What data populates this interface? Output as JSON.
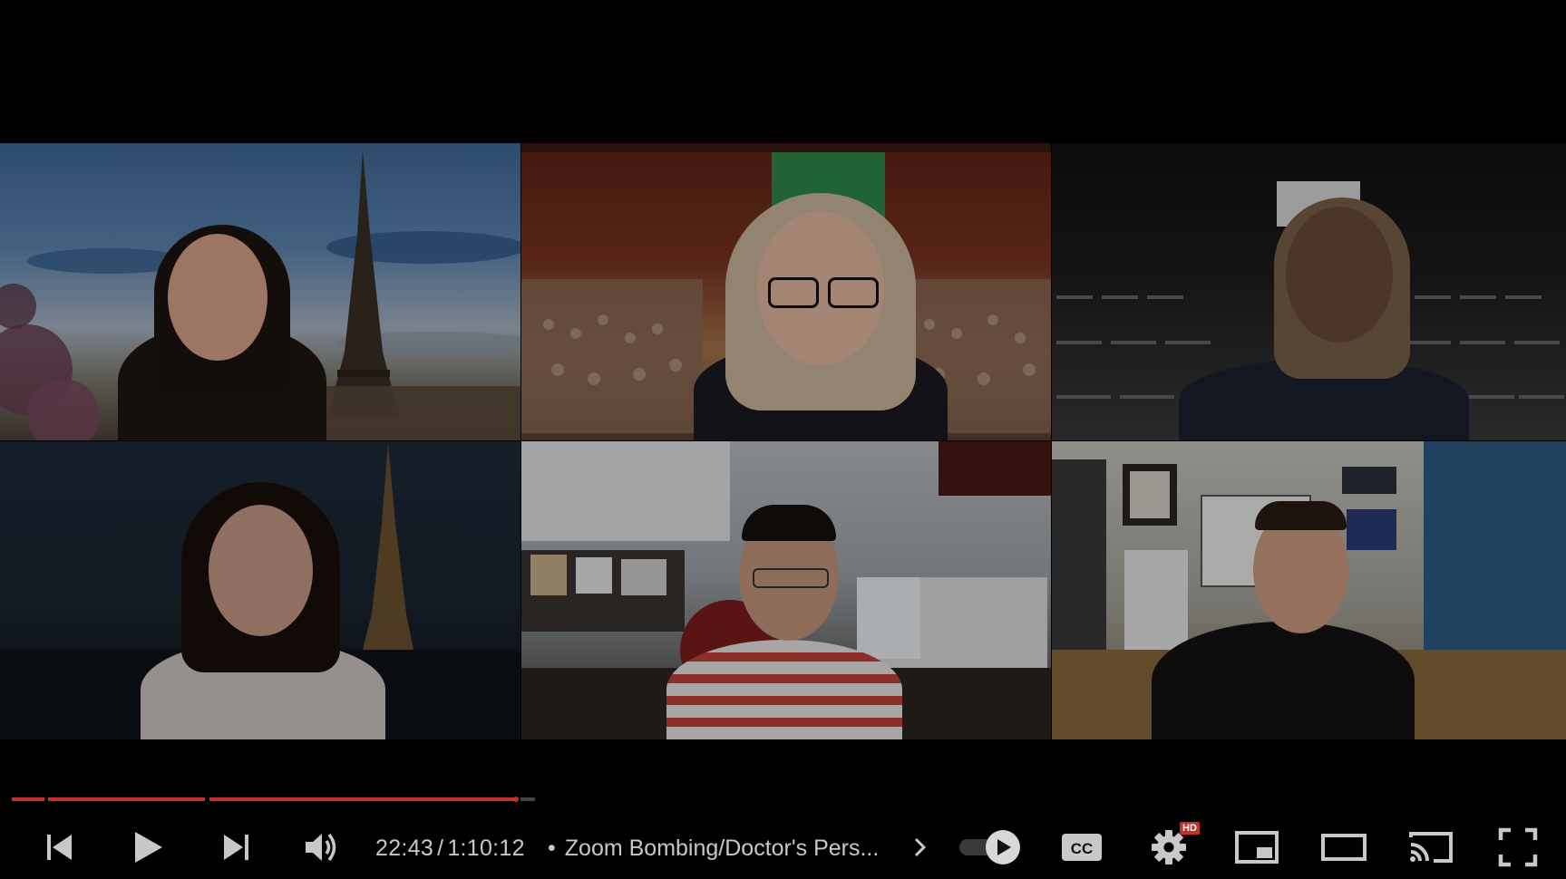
{
  "player": {
    "time_current": "22:43",
    "time_separator": "/",
    "time_total": "1:10:12",
    "chapter_bullet": "•",
    "chapter_title": "Zoom Bombing/Doctor's Pers...",
    "progress_fraction": 0.323,
    "hd_badge": "HD",
    "accent_color": "#c4302b",
    "autoplay_on": true
  },
  "icons": {
    "previous": "skip-previous-icon",
    "play": "play-icon",
    "next": "skip-next-icon",
    "volume": "volume-icon",
    "chapter_arrow": "chevron-right-icon",
    "autoplay": "autoplay-toggle-icon",
    "captions": "cc-icon",
    "settings": "gear-icon",
    "miniplayer": "miniplayer-icon",
    "theater": "theater-mode-icon",
    "cast": "cast-icon",
    "fullscreen": "fullscreen-icon"
  }
}
